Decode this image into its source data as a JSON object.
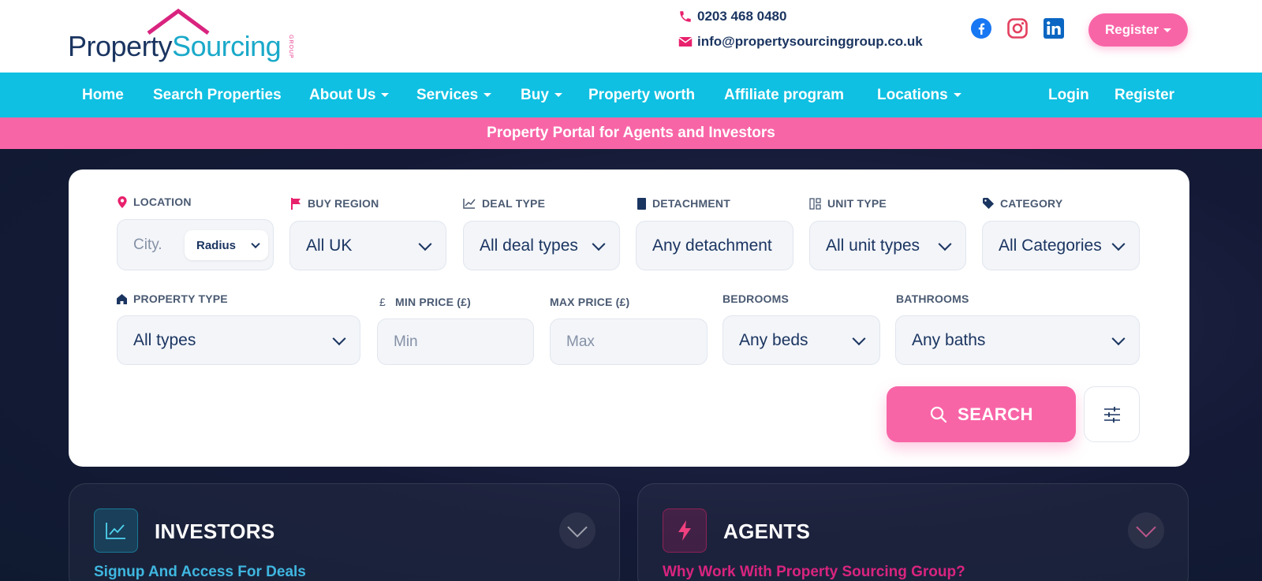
{
  "brand": {
    "logo_text_part1": "Property",
    "logo_text_part2": "Sourcing",
    "logo_group": "GROUP",
    "colors": {
      "navy": "#1b3561",
      "cyan": "#0fc0e2",
      "pink": "#f865a7",
      "magenta": "#d9247f"
    }
  },
  "contact": {
    "phone": "0203 468 0480",
    "email": "info@propertysourcinggroup.co.uk",
    "phone_icon": "phone-icon",
    "email_icon": "envelope-icon"
  },
  "socials": [
    "facebook-icon",
    "instagram-icon",
    "linkedin-icon"
  ],
  "header": {
    "register_label": "Register"
  },
  "nav": {
    "items": [
      {
        "label": "Home",
        "dropdown": false
      },
      {
        "label": "Search Properties",
        "dropdown": false
      },
      {
        "label": "About Us",
        "dropdown": true
      },
      {
        "label": "Services",
        "dropdown": true
      },
      {
        "label": "Buy",
        "dropdown": true
      },
      {
        "label": "Property worth",
        "dropdown": false
      },
      {
        "label": "Affiliate program",
        "dropdown": false
      },
      {
        "label": "Locations",
        "dropdown": true
      }
    ],
    "login": "Login",
    "register": "Register"
  },
  "banner": {
    "text": "Property Portal for Agents and Investors"
  },
  "search": {
    "location": {
      "label": "LOCATION",
      "placeholder": "City.",
      "radius": "Radius"
    },
    "buy_region": {
      "label": "BUY REGION",
      "value": "All UK"
    },
    "deal_type": {
      "label": "DEAL TYPE",
      "value": "All deal types"
    },
    "detachment": {
      "label": "DETACHMENT",
      "value": "Any detachment"
    },
    "unit_type": {
      "label": "UNIT TYPE",
      "value": "All unit types"
    },
    "category": {
      "label": "CATEGORY",
      "value": "All Categories"
    },
    "property_type": {
      "label": "PROPERTY TYPE",
      "value": "All types"
    },
    "min_price": {
      "label": "MIN PRICE (£)",
      "placeholder": "Min",
      "prefix": "£"
    },
    "max_price": {
      "label": "MAX PRICE (£)",
      "placeholder": "Max"
    },
    "bedrooms": {
      "label": "BEDROOMS",
      "value": "Any beds"
    },
    "bathrooms": {
      "label": "BATHROOMS",
      "value": "Any baths"
    },
    "search_button": "SEARCH"
  },
  "panels": {
    "investors": {
      "title": "INVESTORS",
      "subtitle": "Signup And Access For Deals"
    },
    "agents": {
      "title": "AGENTS",
      "subtitle": "Why Work With Property Sourcing Group?"
    }
  }
}
